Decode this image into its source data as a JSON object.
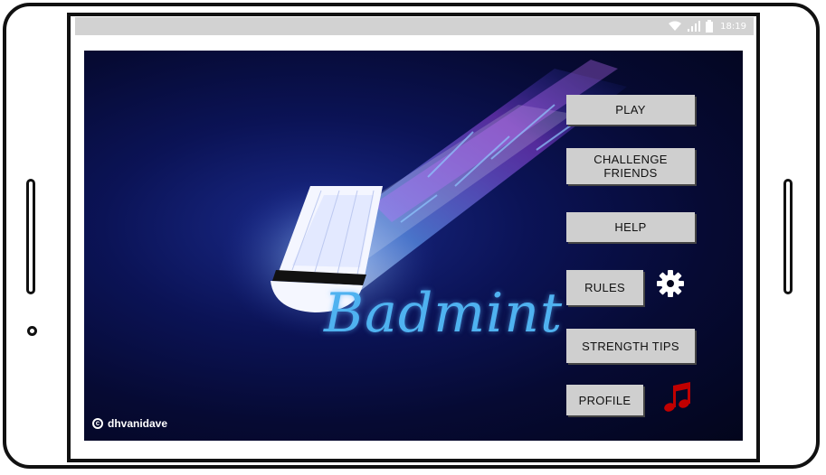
{
  "statusbar": {
    "time": "18:19"
  },
  "hero": {
    "brand_text": "Badmint",
    "copyright_symbol": "c",
    "copyright_text": "dhvanidave"
  },
  "menu": {
    "play": "PLAY",
    "challenge_friends": "CHALLENGE FRIENDS",
    "help": "HELP",
    "rules": "RULES",
    "strength_tips": "STRENGTH TIPS",
    "profile": "PROFILE"
  },
  "icons": {
    "settings": "gear-icon",
    "music": "music-note-icon",
    "wifi": "wifi-icon",
    "signal": "signal-icon",
    "battery": "battery-icon"
  },
  "colors": {
    "music_icon": "#c00000",
    "brand_text": "#4fb2f0",
    "button_bg": "#cfcfcf"
  }
}
